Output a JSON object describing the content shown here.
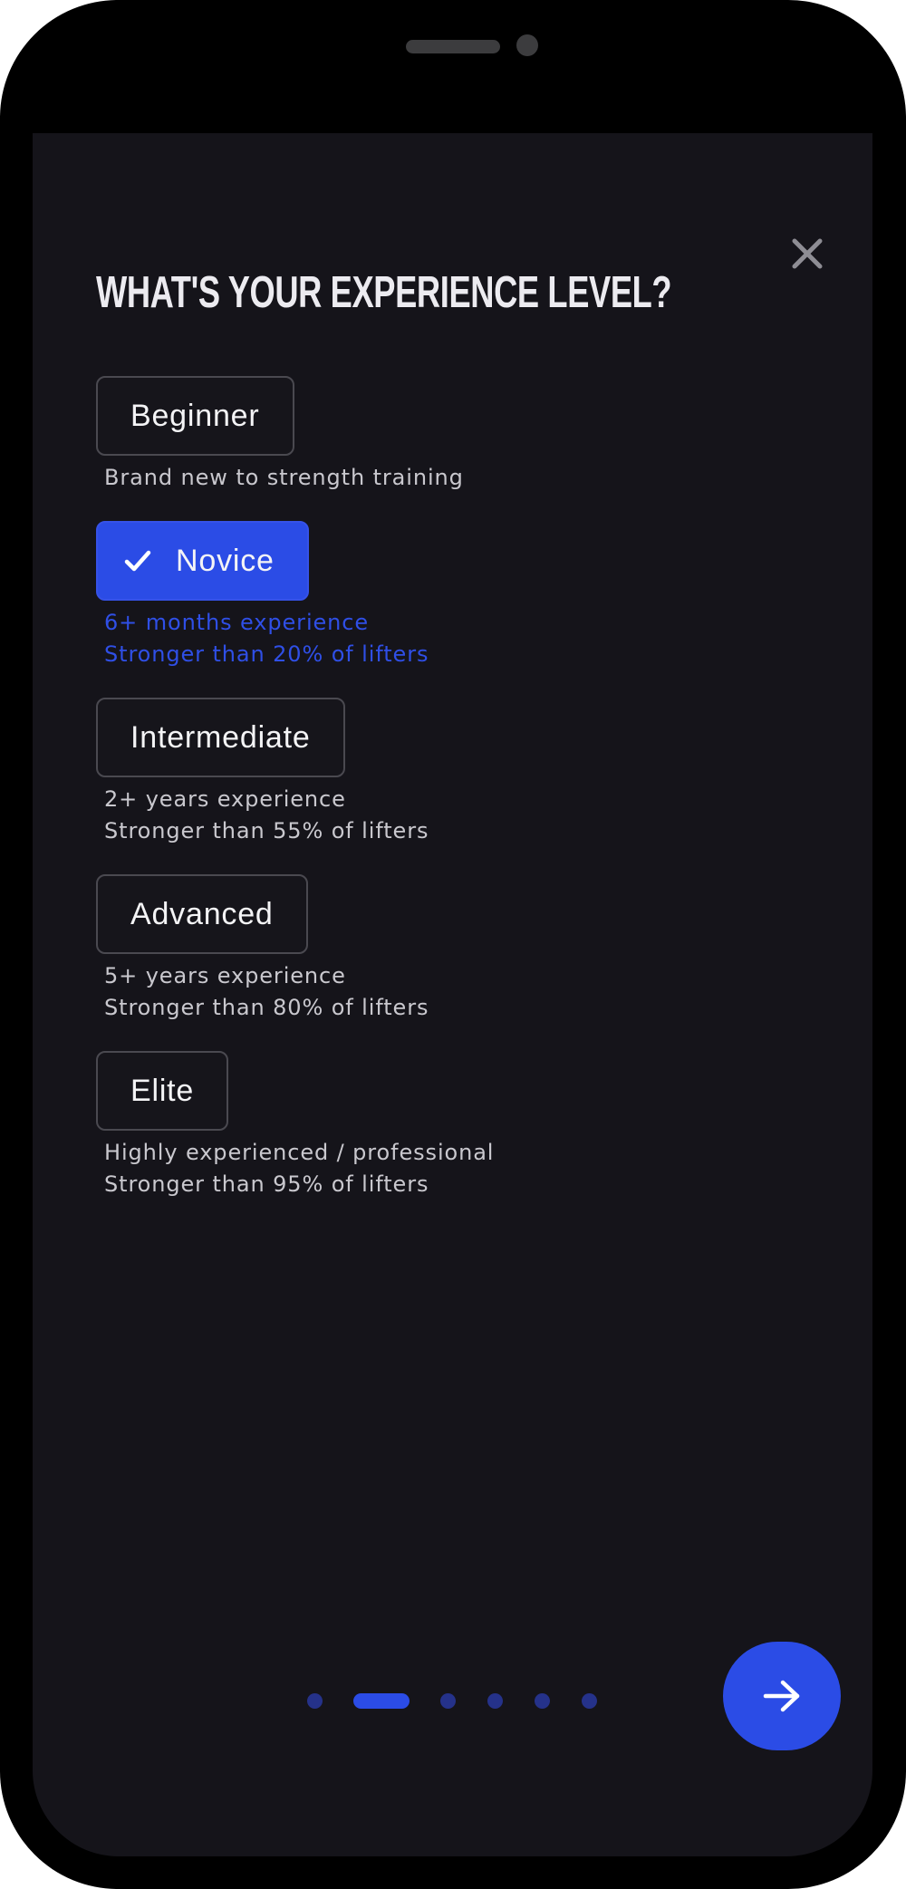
{
  "header": {
    "title": "WHAT'S YOUR EXPERIENCE LEVEL?",
    "close_icon": "close-icon"
  },
  "options": [
    {
      "label": "Beginner",
      "selected": false,
      "lines": [
        "Brand new to strength training"
      ]
    },
    {
      "label": "Novice",
      "selected": true,
      "icon": "check-icon",
      "lines": [
        "6+ months experience",
        "Stronger than 20% of lifters"
      ]
    },
    {
      "label": "Intermediate",
      "selected": false,
      "lines": [
        "2+ years experience",
        "Stronger than 55% of lifters"
      ]
    },
    {
      "label": "Advanced",
      "selected": false,
      "lines": [
        "5+ years experience",
        "Stronger than 80% of lifters"
      ]
    },
    {
      "label": "Elite",
      "selected": false,
      "lines": [
        "Highly experienced / professional",
        "Stronger than 95% of lifters"
      ]
    }
  ],
  "pagination": {
    "total": 6,
    "current": 2
  },
  "next_button": {
    "icon": "arrow-right-icon"
  },
  "colors": {
    "accent": "#2b4ce6",
    "background": "#15141a",
    "text": "#f4f4f6",
    "muted_text": "#c9c8ce",
    "inactive_dot": "#25328a"
  }
}
